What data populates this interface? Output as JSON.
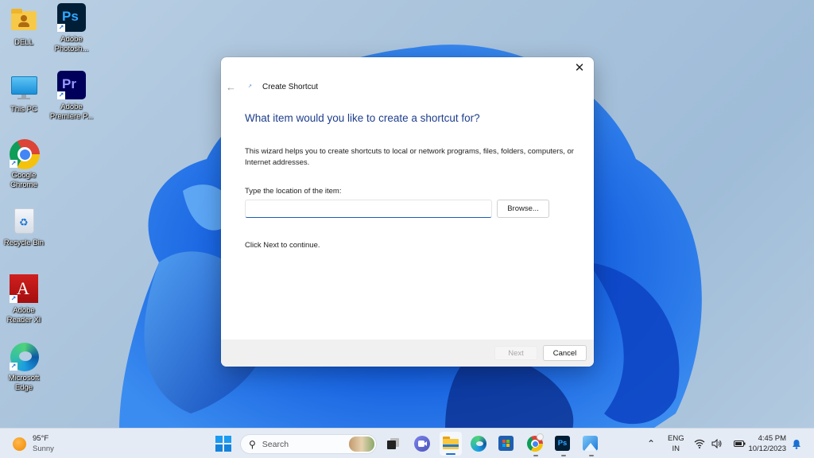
{
  "desktop": {
    "icons": [
      {
        "label": "DELL",
        "icon": "user-folder-icon"
      },
      {
        "label": "Adobe Photosh...",
        "icon": "photoshop-icon"
      },
      {
        "label": "This PC",
        "icon": "monitor-icon"
      },
      {
        "label": "Adobe Premiere P...",
        "icon": "premiere-icon"
      },
      {
        "label": "Google Chrome",
        "icon": "chrome-icon"
      },
      {
        "label": "Recycle Bin",
        "icon": "recycle-bin-icon"
      },
      {
        "label": "Adobe Reader XI",
        "icon": "acrobat-icon"
      },
      {
        "label": "Microsoft Edge",
        "icon": "edge-icon"
      }
    ],
    "shortcut_badge": "↗",
    "ps_text": "Ps",
    "pr_text": "Pr"
  },
  "dialog": {
    "title": "Create Shortcut",
    "close_glyph": "✕",
    "back_glyph": "←",
    "heading": "What item would you like to create a shortcut for?",
    "description": "This wizard helps you to create shortcuts to local or network programs, files, folders, computers, or Internet addresses.",
    "location_label": "Type the location of the item:",
    "location_value": "",
    "browse_label": "Browse...",
    "continue_text": "Click Next to continue.",
    "next_label": "Next",
    "next_disabled": true,
    "cancel_label": "Cancel"
  },
  "taskbar": {
    "weather": {
      "temp": "95°F",
      "condition": "Sunny"
    },
    "search_placeholder": "Search",
    "search_glyph": "⚲",
    "apps": [
      {
        "name": "start",
        "icon": "windows-start-icon"
      },
      {
        "name": "task-view",
        "icon": "task-view-icon"
      },
      {
        "name": "teams-chat",
        "icon": "teams-chat-icon"
      },
      {
        "name": "file-explorer",
        "icon": "file-explorer-icon",
        "active": true
      },
      {
        "name": "edge",
        "icon": "edge-icon"
      },
      {
        "name": "store",
        "icon": "microsoft-store-icon"
      },
      {
        "name": "chrome",
        "icon": "chrome-icon",
        "running": true
      },
      {
        "name": "photoshop",
        "icon": "photoshop-icon",
        "running": true
      },
      {
        "name": "photos",
        "icon": "photos-icon",
        "running": true
      }
    ],
    "tray": {
      "chevron_glyph": "⌃",
      "language_line1": "ENG",
      "language_line2": "IN",
      "wifi_glyph": "◠",
      "volume_glyph": "🔈",
      "time": "4:45 PM",
      "date": "10/12/2023",
      "bell_glyph": "🔔"
    }
  },
  "colors": {
    "accent": "#1a5fb4",
    "heading": "#1e3e8c",
    "taskbar_bg": "#e4ebf5"
  }
}
